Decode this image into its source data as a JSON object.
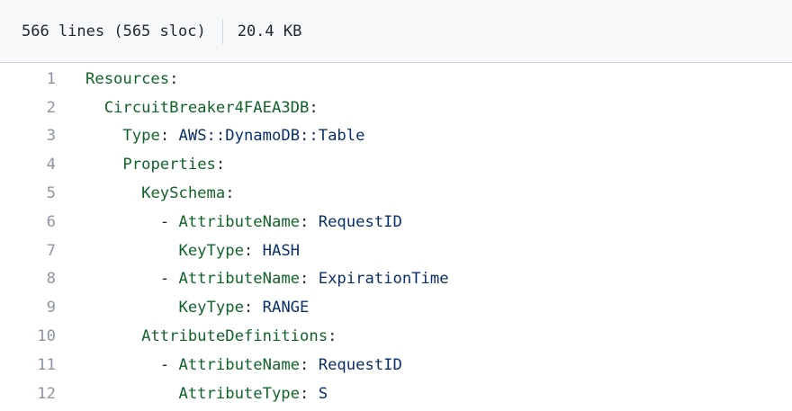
{
  "file_info": {
    "lines_label": "566 lines (565 sloc)",
    "size_label": "20.4 KB"
  },
  "code": {
    "lines": [
      {
        "num": "1",
        "indent": "",
        "dash": "",
        "key": "Resources",
        "value": ""
      },
      {
        "num": "2",
        "indent": "  ",
        "dash": "",
        "key": "CircuitBreaker4FAEA3DB",
        "value": ""
      },
      {
        "num": "3",
        "indent": "    ",
        "dash": "",
        "key": "Type",
        "value": "AWS::DynamoDB::Table"
      },
      {
        "num": "4",
        "indent": "    ",
        "dash": "",
        "key": "Properties",
        "value": ""
      },
      {
        "num": "5",
        "indent": "      ",
        "dash": "",
        "key": "KeySchema",
        "value": ""
      },
      {
        "num": "6",
        "indent": "        ",
        "dash": "- ",
        "key": "AttributeName",
        "value": "RequestID"
      },
      {
        "num": "7",
        "indent": "          ",
        "dash": "",
        "key": "KeyType",
        "value": "HASH"
      },
      {
        "num": "8",
        "indent": "        ",
        "dash": "- ",
        "key": "AttributeName",
        "value": "ExpirationTime"
      },
      {
        "num": "9",
        "indent": "          ",
        "dash": "",
        "key": "KeyType",
        "value": "RANGE"
      },
      {
        "num": "10",
        "indent": "      ",
        "dash": "",
        "key": "AttributeDefinitions",
        "value": ""
      },
      {
        "num": "11",
        "indent": "        ",
        "dash": "- ",
        "key": "AttributeName",
        "value": "RequestID"
      },
      {
        "num": "12",
        "indent": "          ",
        "dash": "",
        "key": "AttributeType",
        "value": "S"
      }
    ]
  },
  "colors": {
    "key": "#116329",
    "value": "#0a3069",
    "line_number": "#8c959f",
    "header_bg": "#f6f8fa",
    "border": "#d0d7de"
  }
}
